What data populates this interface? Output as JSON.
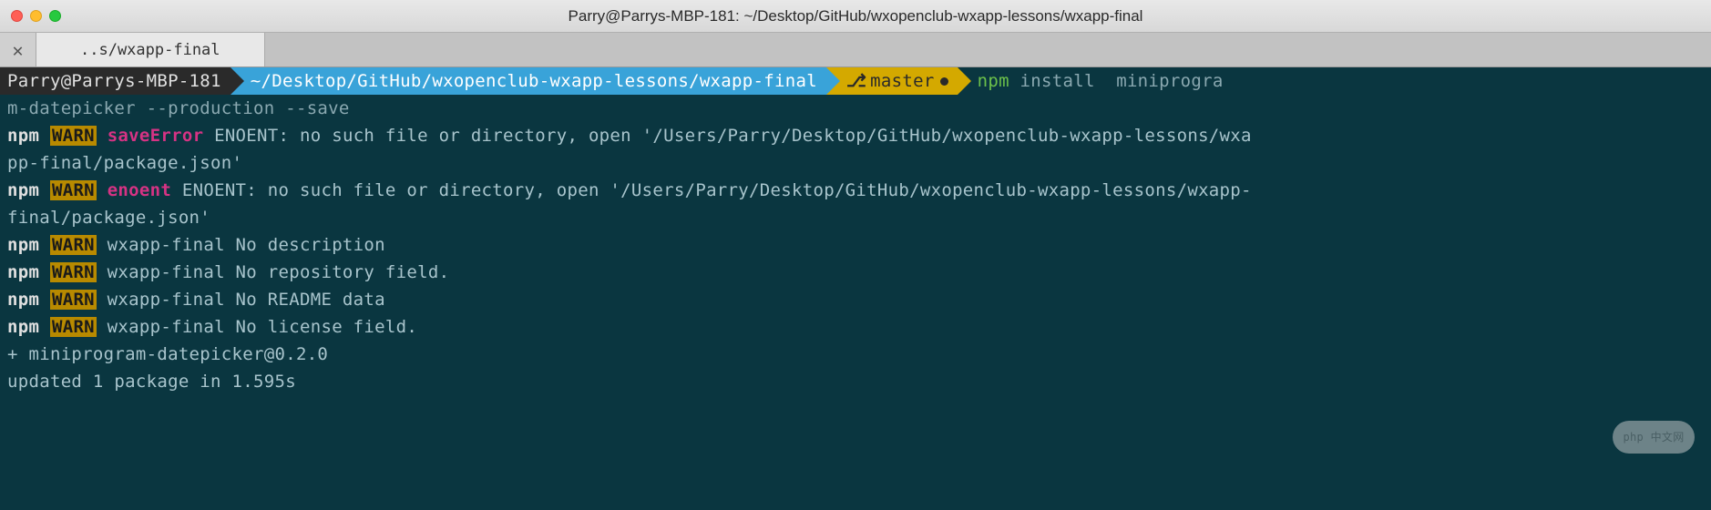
{
  "window": {
    "title": "Parry@Parrys-MBP-181: ~/Desktop/GitHub/wxopenclub-wxapp-lessons/wxapp-final"
  },
  "tab": {
    "label": "..s/wxapp-final"
  },
  "prompt": {
    "user": "Parry@Parrys-MBP-181",
    "path": "~/Desktop/GitHub/wxopenclub-wxapp-lessons/wxapp-final",
    "branch": "master",
    "command_first": "npm",
    "command_rest": " install  miniprogra",
    "command_wrap": "m-datepicker --production --save"
  },
  "output": {
    "lines": [
      {
        "npm": "npm",
        "warn": "WARN",
        "key": "saveError",
        "msg": " ENOENT: no such file or directory, open '/Users/Parry/Desktop/GitHub/wxopenclub-wxapp-lessons/wxa"
      },
      {
        "cont": "pp-final/package.json'"
      },
      {
        "npm": "npm",
        "warn": "WARN",
        "key": "enoent",
        "msg": " ENOENT: no such file or directory, open '/Users/Parry/Desktop/GitHub/wxopenclub-wxapp-lessons/wxapp-"
      },
      {
        "cont": "final/package.json'"
      },
      {
        "npm": "npm",
        "warn": "WARN",
        "msg": " wxapp-final No description"
      },
      {
        "npm": "npm",
        "warn": "WARN",
        "msg": " wxapp-final No repository field."
      },
      {
        "npm": "npm",
        "warn": "WARN",
        "msg": " wxapp-final No README data"
      },
      {
        "npm": "npm",
        "warn": "WARN",
        "msg": " wxapp-final No license field."
      }
    ],
    "blank": "",
    "result1": "+ miniprogram-datepicker@0.2.0",
    "result2": "updated 1 package in 1.595s"
  },
  "watermark": "php 中文网"
}
